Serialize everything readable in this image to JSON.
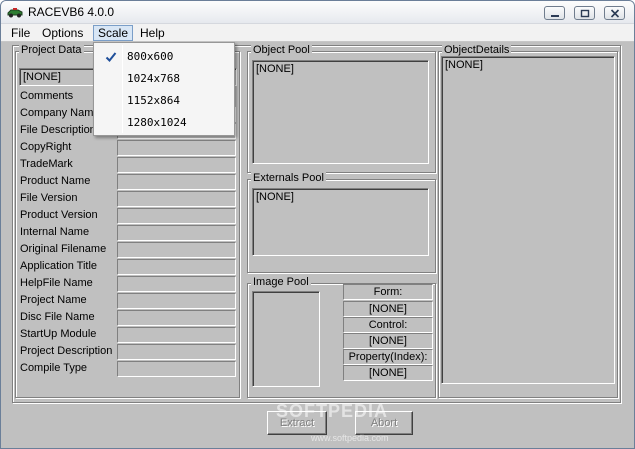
{
  "window": {
    "title": "RACEVB6 4.0.0"
  },
  "menu": {
    "items": [
      "File",
      "Options",
      "Scale",
      "Help"
    ],
    "open": "Scale"
  },
  "scale_menu": {
    "options": [
      "800x600",
      "1024x768",
      "1152x864",
      "1280x1024"
    ],
    "selected": "800x600"
  },
  "project_data": {
    "caption": "Project Data",
    "combo_value": "[NONE]",
    "fields": [
      "Comments",
      "Company Name",
      "File Description",
      "CopyRight",
      "TradeMark",
      "Product Name",
      "File Version",
      "Product Version",
      "Internal Name",
      "Original Filename",
      "Application Title",
      "HelpFile Name",
      "Project Name",
      "Disc File Name",
      "StartUp Module",
      "Project Description",
      "Compile Type"
    ]
  },
  "object_pool": {
    "caption": "Object Pool",
    "value": "[NONE]"
  },
  "externals_pool": {
    "caption": "Externals Pool",
    "value": "[NONE]"
  },
  "image_pool": {
    "caption": "Image Pool",
    "form_label": "Form:",
    "form_value": "[NONE]",
    "control_label": "Control:",
    "control_value": "[NONE]",
    "property_label": "Property(Index):",
    "property_value": "[NONE]"
  },
  "object_details": {
    "caption": "ObjectDetails",
    "value": "[NONE]"
  },
  "buttons": {
    "extract": "Extract",
    "abort": "Abort"
  },
  "watermark": {
    "text": "SOFTPEDIA",
    "url": "www.softpedia.com"
  }
}
